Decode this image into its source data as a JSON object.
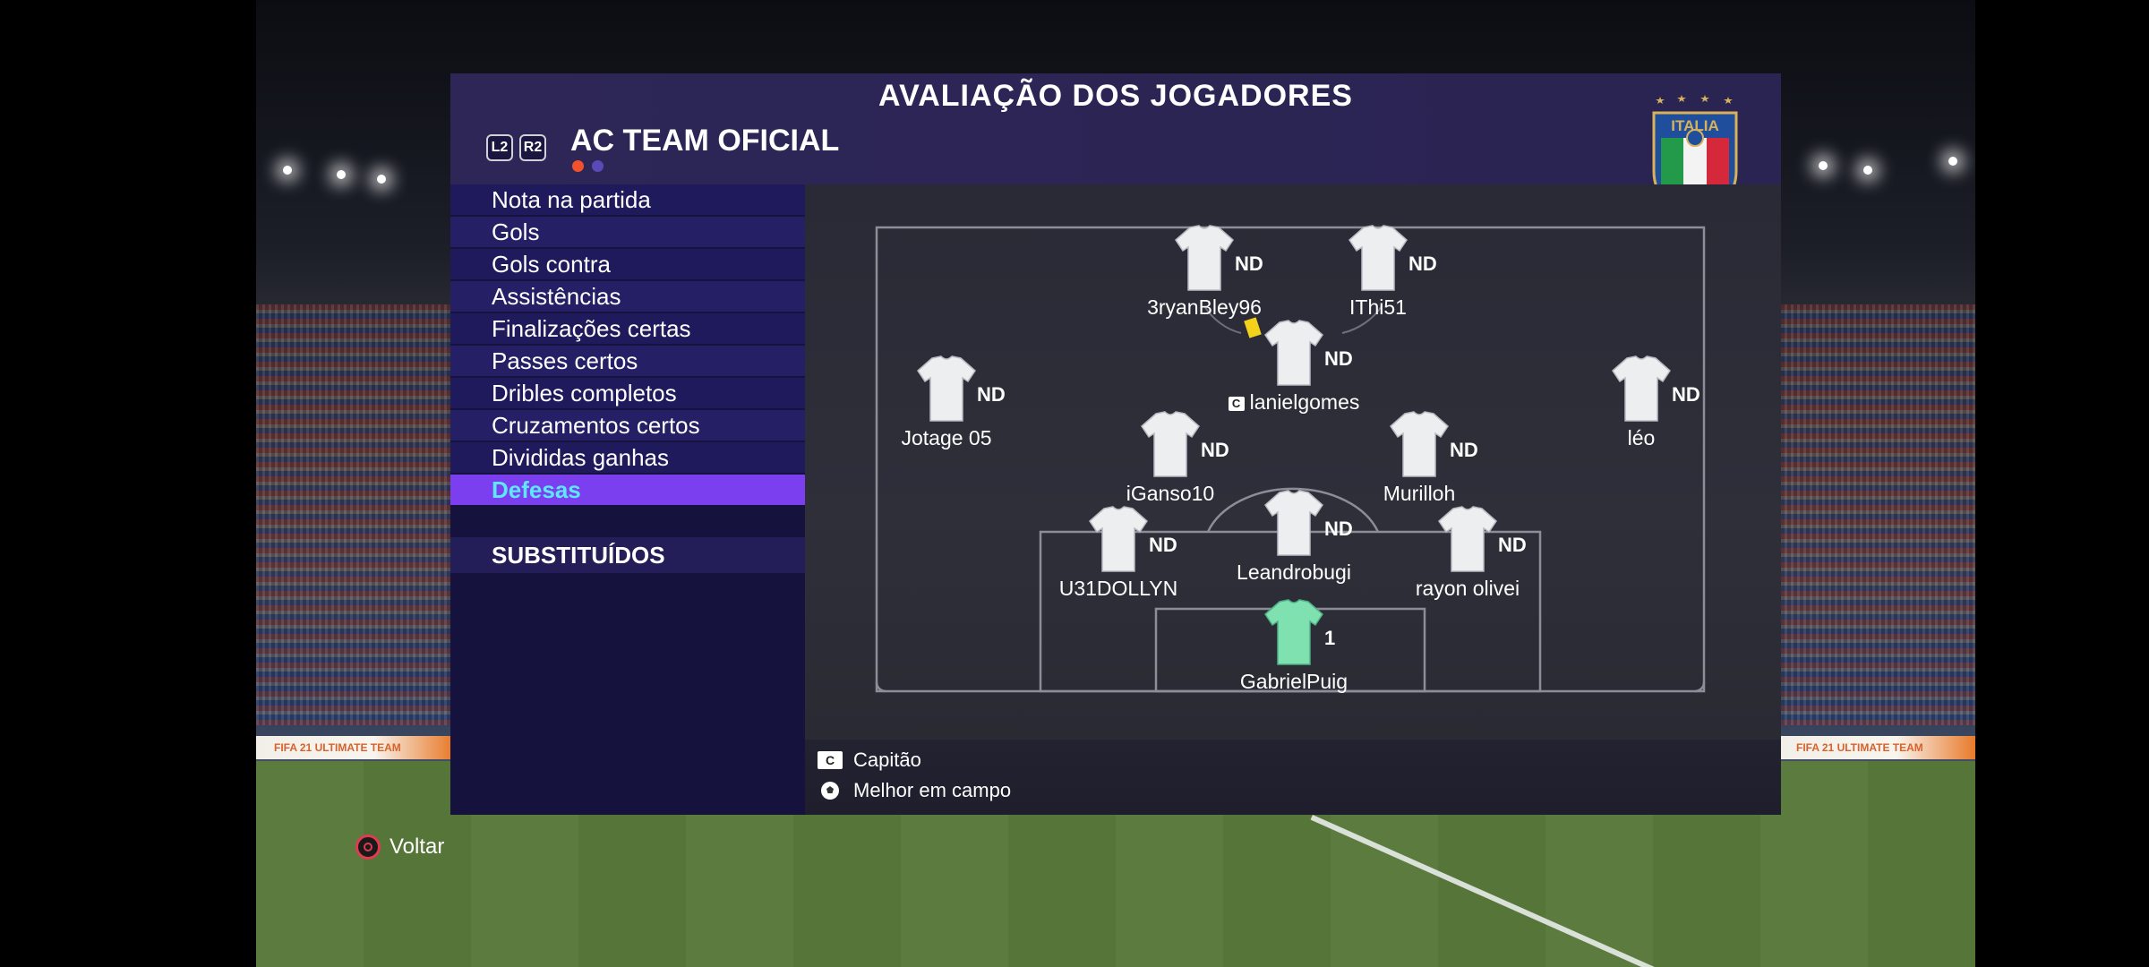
{
  "header": {
    "title": "AVALIAÇÃO DOS JOGADORES",
    "button_left": "L2",
    "button_right": "R2",
    "team_name": "AC TEAM OFICIAL",
    "crest_text": "ITALIA",
    "indicator_colors": [
      "#f2522b",
      "#5a4ab8"
    ]
  },
  "ad_boards": {
    "left": "FIFA 21 ULTIMATE TEAM",
    "right": "FIFA 21 ULTIMATE TEAM"
  },
  "stats_menu": {
    "items": [
      {
        "label": "Nota na partida"
      },
      {
        "label": "Gols"
      },
      {
        "label": "Gols contra"
      },
      {
        "label": "Assistências"
      },
      {
        "label": "Finalizações certas"
      },
      {
        "label": "Passes certos"
      },
      {
        "label": "Dribles completos"
      },
      {
        "label": "Cruzamentos certos"
      },
      {
        "label": "Divididas ganhas"
      },
      {
        "label": "Defesas",
        "selected": true
      }
    ],
    "selected_index": 9
  },
  "substitutes_header": "SUBSTITUÍDOS",
  "players": [
    {
      "name": "3ryanBley96",
      "rating": "ND",
      "shirt": "white"
    },
    {
      "name": "IThi51",
      "rating": "ND",
      "shirt": "white"
    },
    {
      "name": "lanielgomes",
      "rating": "ND",
      "shirt": "white",
      "captain": true,
      "captain_badge": "C"
    },
    {
      "name": "Jotage 05",
      "rating": "ND",
      "shirt": "white"
    },
    {
      "name": "léo",
      "rating": "ND",
      "shirt": "white"
    },
    {
      "name": "iGanso10",
      "rating": "ND",
      "shirt": "white"
    },
    {
      "name": "Murilloh",
      "rating": "ND",
      "shirt": "white"
    },
    {
      "name": "U31DOLLYN",
      "rating": "ND",
      "shirt": "white"
    },
    {
      "name": "Leandrobugi",
      "rating": "ND",
      "shirt": "white"
    },
    {
      "name": "rayon olivei",
      "rating": "ND",
      "shirt": "white"
    },
    {
      "name": "GabrielPuig",
      "rating": "1",
      "shirt": "goalkeeper"
    }
  ],
  "legend": {
    "captain_icon": "C",
    "captain_label": "Capitão",
    "motm_label": "Melhor em campo"
  },
  "back_control": {
    "label": "Voltar",
    "icon": "circle-button-icon"
  },
  "colors": {
    "panel": "#16123e",
    "menu_selected": "#7b3ff0",
    "menu_selected_text": "#5ee8ff",
    "yellow_card": "#f4d21c",
    "goalkeeper_shirt": "#7fe0b0"
  }
}
